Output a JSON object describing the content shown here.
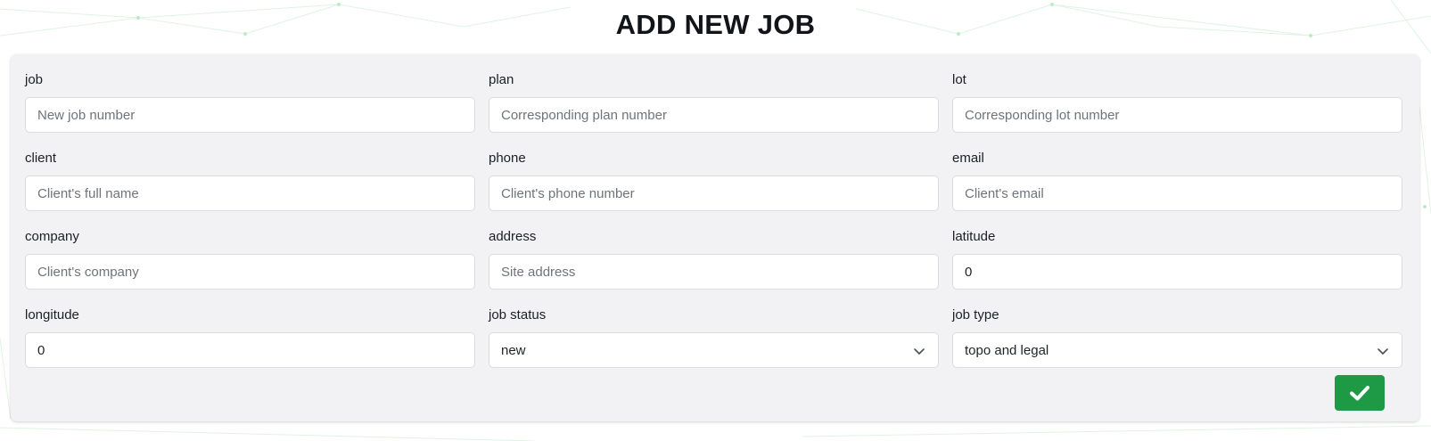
{
  "page": {
    "title": "ADD NEW JOB"
  },
  "form": {
    "fields": [
      {
        "label": "job",
        "placeholder": "New job number",
        "value": ""
      },
      {
        "label": "plan",
        "placeholder": "Corresponding plan number",
        "value": ""
      },
      {
        "label": "lot",
        "placeholder": "Corresponding lot number",
        "value": ""
      },
      {
        "label": "client",
        "placeholder": "Client's full name",
        "value": ""
      },
      {
        "label": "phone",
        "placeholder": "Client's phone number",
        "value": ""
      },
      {
        "label": "email",
        "placeholder": "Client's email",
        "value": ""
      },
      {
        "label": "company",
        "placeholder": "Client's company",
        "value": ""
      },
      {
        "label": "address",
        "placeholder": "Site address",
        "value": ""
      },
      {
        "label": "latitude",
        "placeholder": "",
        "value": "0"
      },
      {
        "label": "longitude",
        "placeholder": "",
        "value": "0"
      }
    ],
    "selects": [
      {
        "label": "job status",
        "selected": "new"
      },
      {
        "label": "job type",
        "selected": "topo and legal"
      }
    ],
    "submit": {
      "icon": "checkmark-icon"
    }
  },
  "colors": {
    "accent": "#1e9a46",
    "card_background": "#f2f2f4",
    "background_network": "#a8e6b4"
  }
}
